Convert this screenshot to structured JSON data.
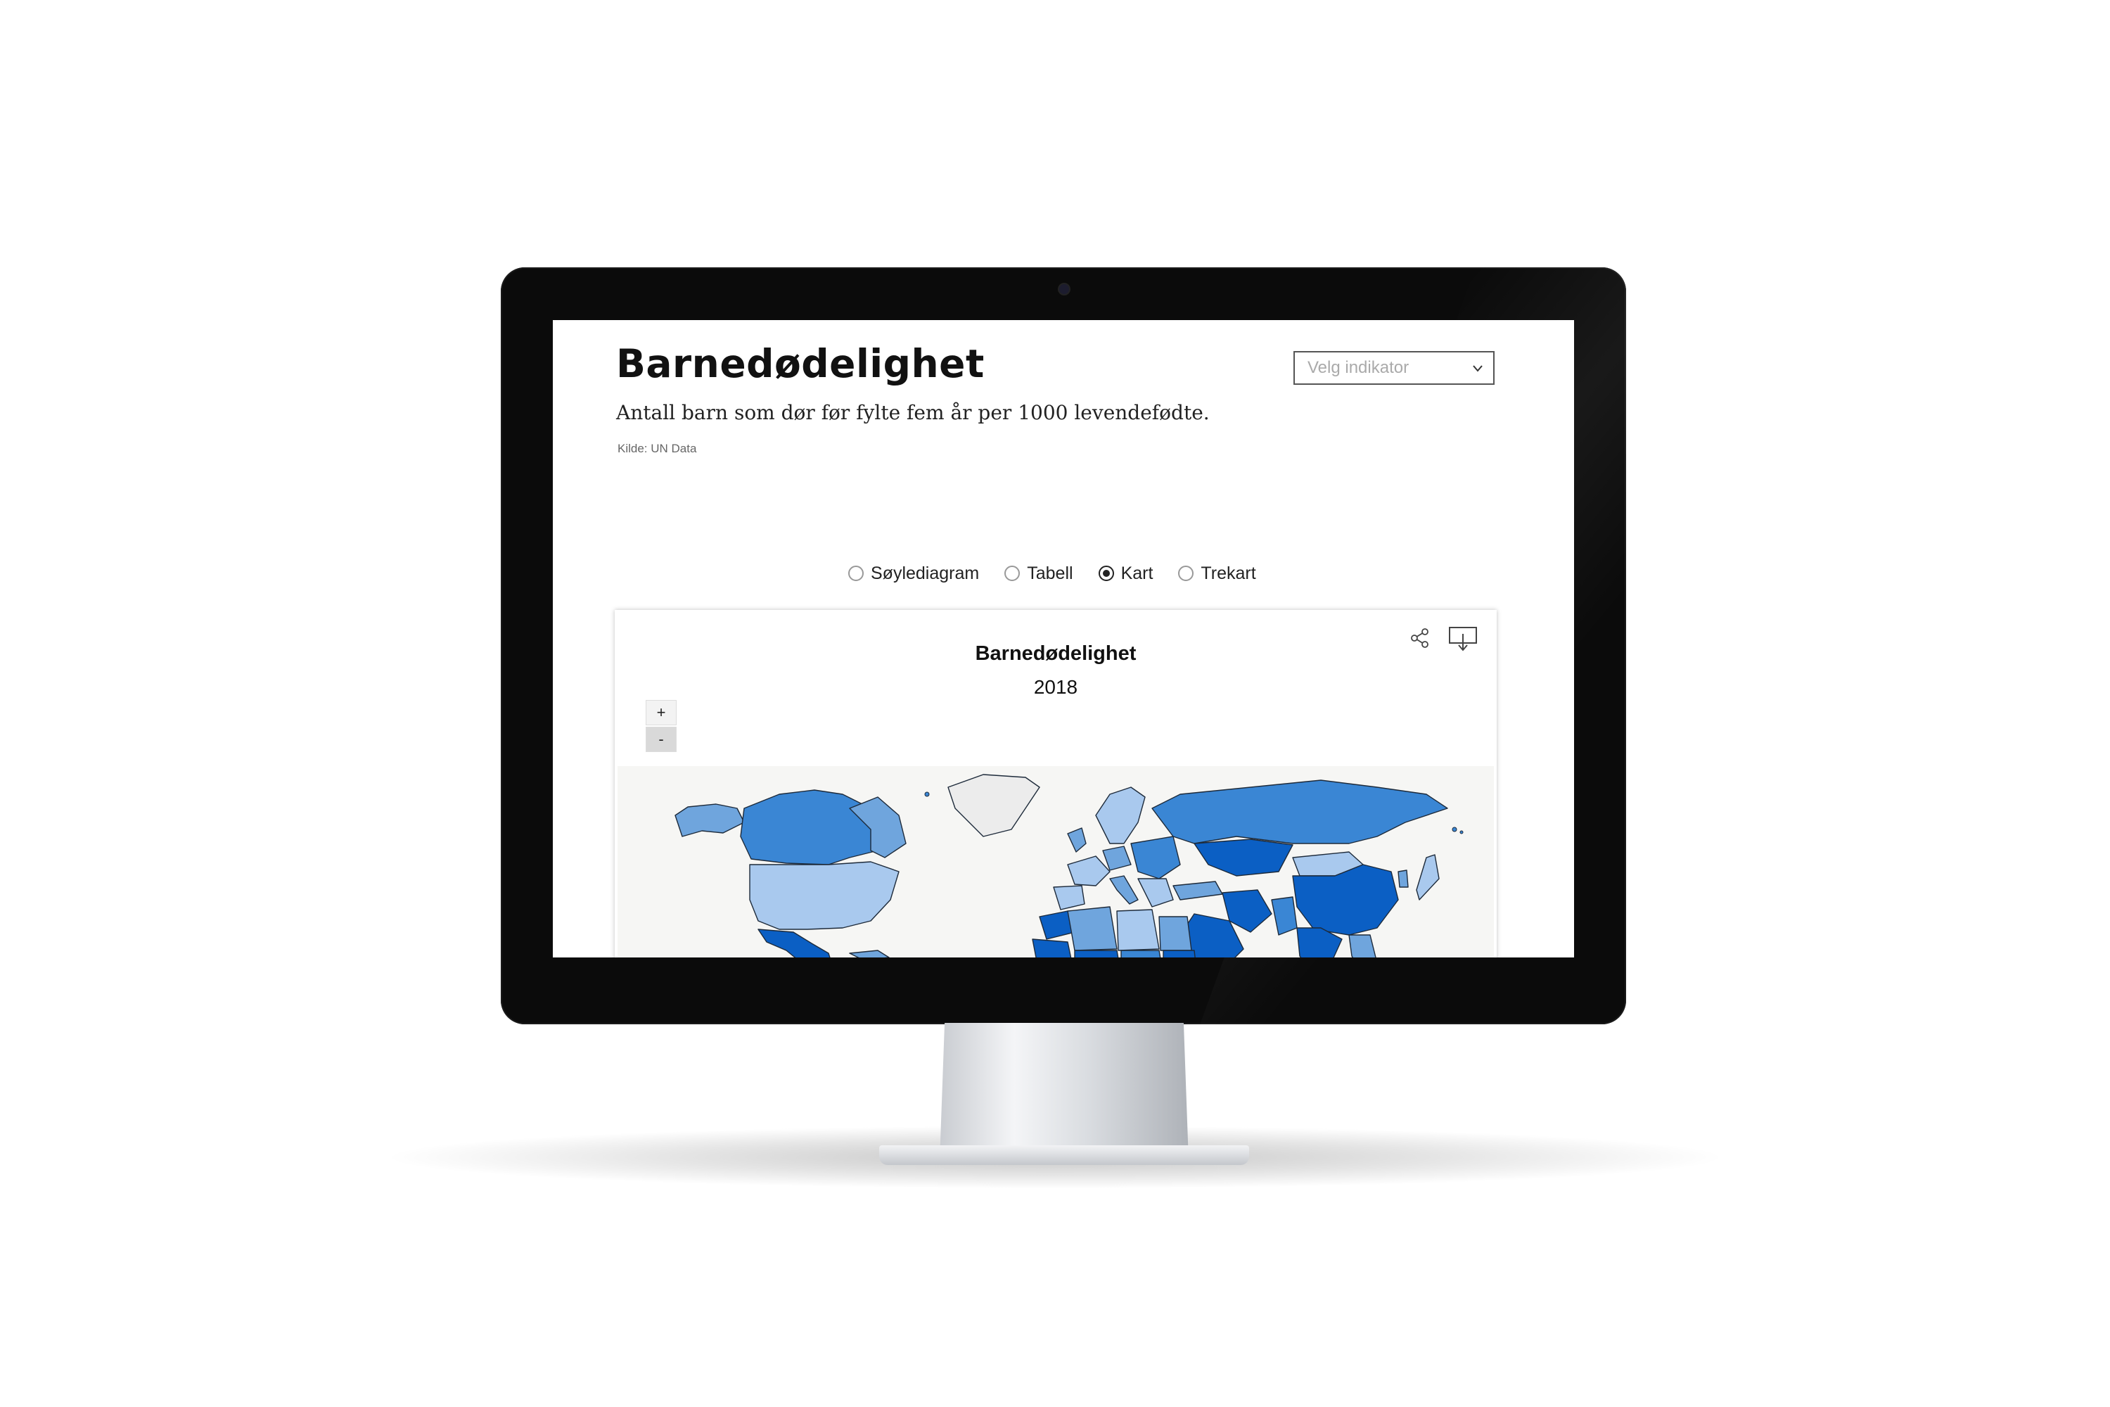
{
  "page": {
    "title": "Barnedødelighet",
    "subtitle": "Antall barn som dør før fylte fem år per 1000 levendefødte.",
    "source": "Kilde: UN Data"
  },
  "indicator_select": {
    "placeholder": "Velg indikator"
  },
  "view_options": [
    {
      "label": "Søylediagram",
      "selected": false
    },
    {
      "label": "Tabell",
      "selected": false
    },
    {
      "label": "Kart",
      "selected": true
    },
    {
      "label": "Trekart",
      "selected": false
    }
  ],
  "chart": {
    "title": "Barnedødelighet",
    "subtitle": "2018",
    "zoom_in": "+",
    "zoom_out": "-",
    "icons": {
      "share": "share-icon",
      "download": "download-icon"
    }
  },
  "colors": {
    "dark": "#0b5fc4",
    "mid": "#3a86d4",
    "light": "#6fa5dd",
    "pale": "#a9c9ee",
    "none": "#ececec",
    "map_bg": "#f6f6f4"
  }
}
